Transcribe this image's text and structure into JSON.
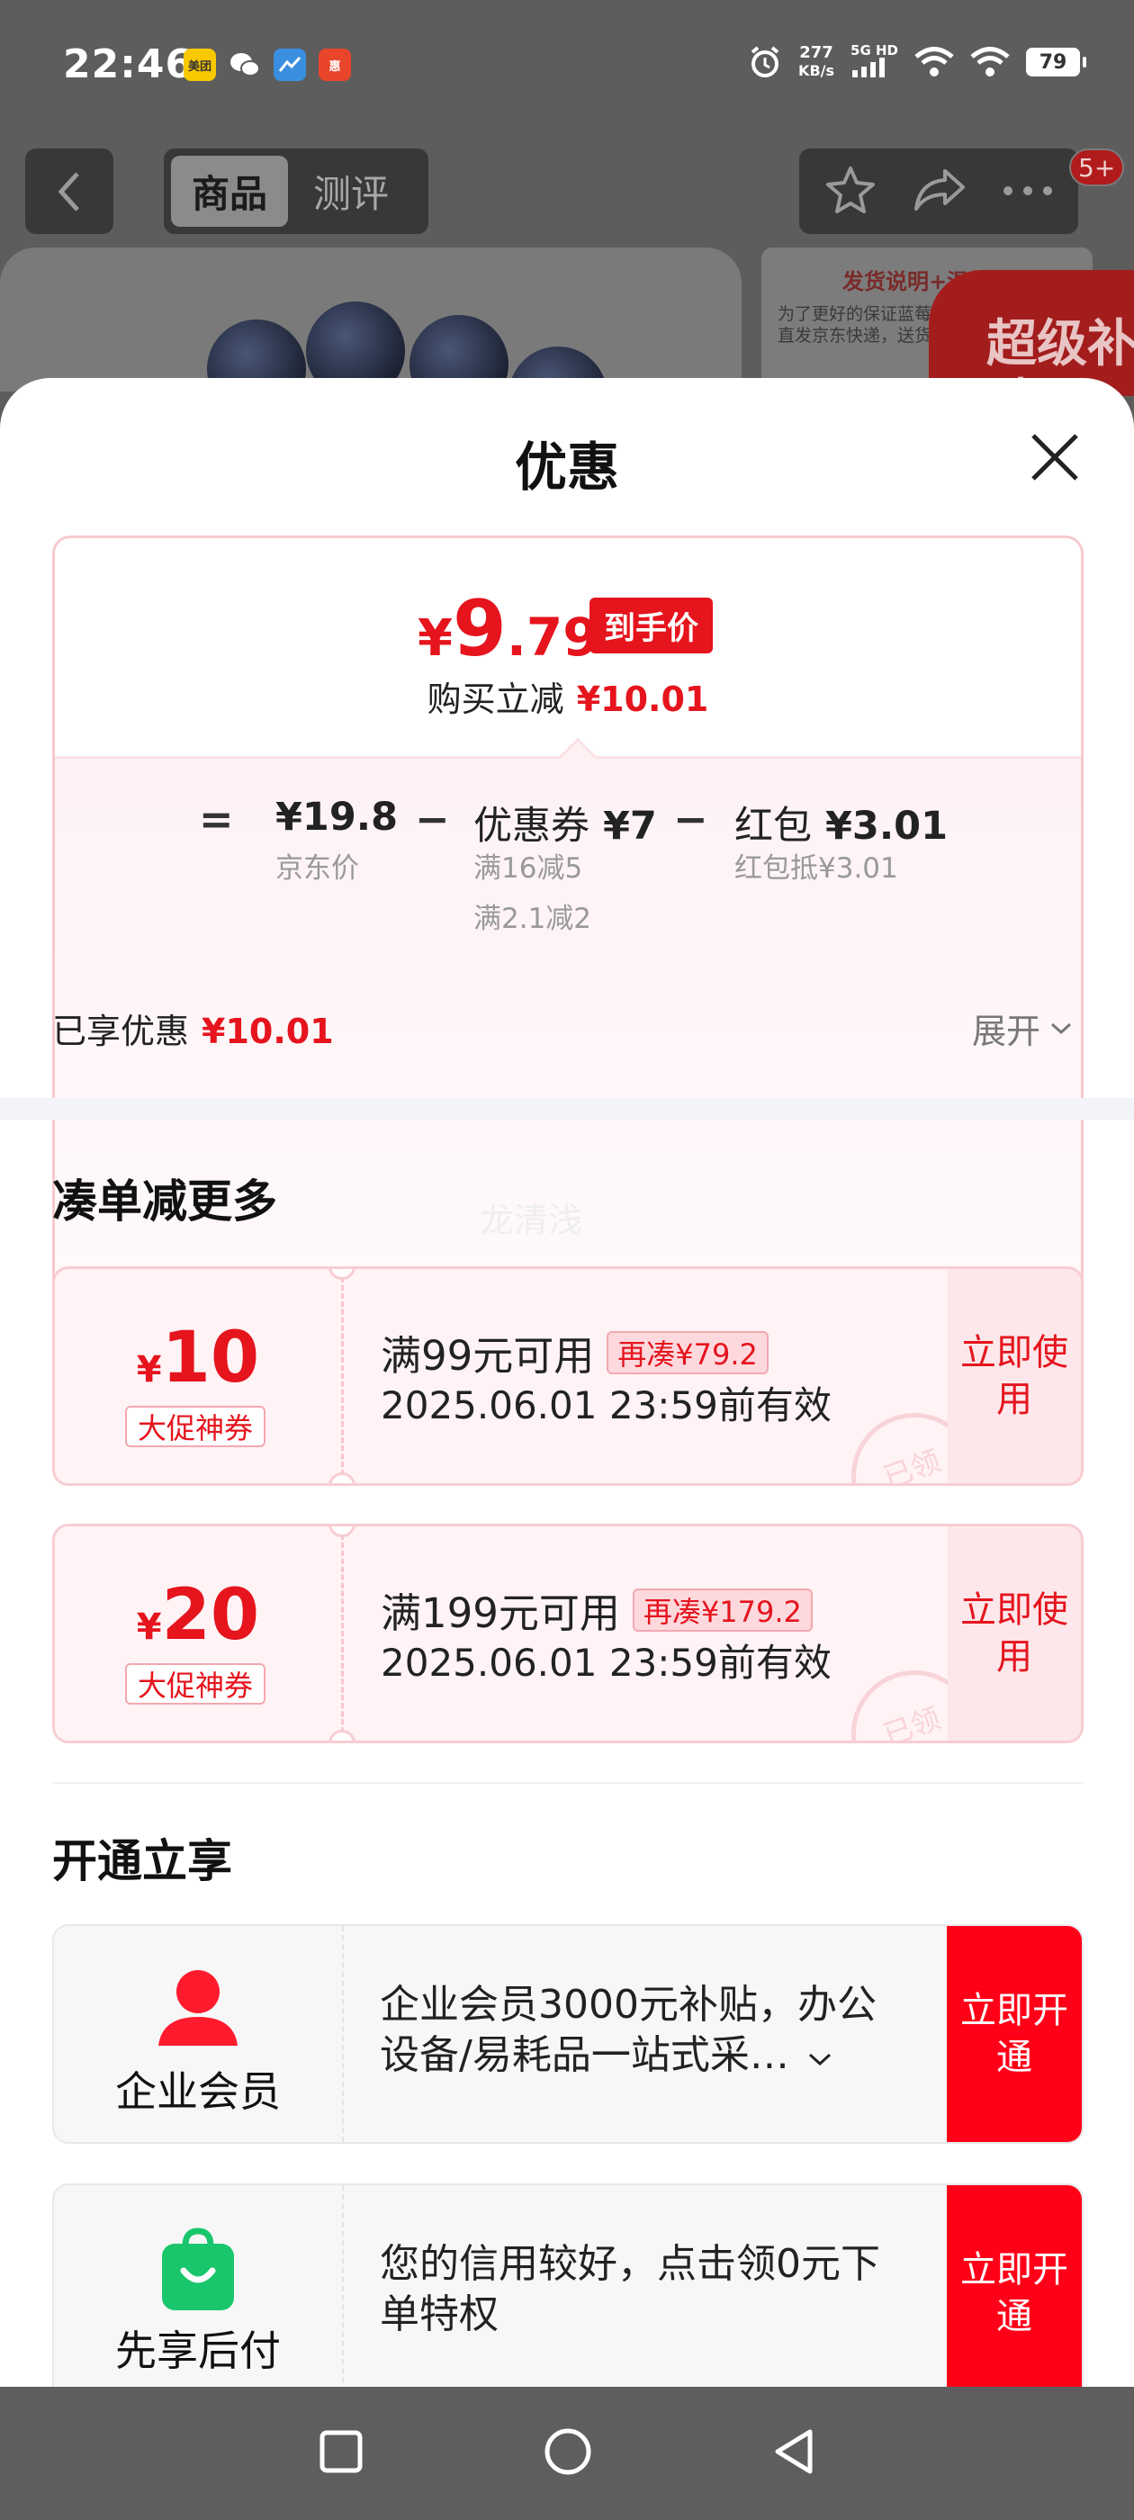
{
  "status_bar": {
    "time": "22:46",
    "app_icons": [
      "meituan-icon",
      "wechat-icon",
      "app-icon",
      "app-icon"
    ],
    "app_icon_labels": [
      "美团",
      "",
      "",
      "惠"
    ],
    "net_speed": "277",
    "net_unit": "KB/s",
    "signal_label": "5G HD",
    "battery": "79"
  },
  "page_header": {
    "tabs": [
      "商品",
      "测评"
    ],
    "active_tab": "商品",
    "message_badge": "5+"
  },
  "background_promo": {
    "title": "发货说明+温馨提示",
    "text": "为了更好的保证蓝莓的 直发京东快递，送货",
    "super_badge": "超级补贴日"
  },
  "sheet": {
    "title": "优惠",
    "final_price": {
      "symbol": "¥",
      "integer": "9",
      "decimal": ".79",
      "badge": "到手价"
    },
    "instant_discount": {
      "label": "购买立减",
      "amount": "¥10.01"
    },
    "calc": {
      "equals": "=",
      "minus": "−",
      "jd_price": {
        "value": "¥19.8",
        "label": "京东价"
      },
      "coupon": {
        "label": "优惠券",
        "value": "¥7",
        "details": [
          "满16减5",
          "满2.1减2"
        ]
      },
      "redpacket": {
        "label": "红包",
        "value": "¥3.01",
        "detail": "红包抵¥3.01"
      }
    },
    "enjoyed": {
      "label": "已享优惠",
      "amount": "¥10.01"
    },
    "expand_label": "展开",
    "section_more": "凑单减更多",
    "watermark": "龙清浅",
    "coupons": [
      {
        "symbol": "¥",
        "amount": "10",
        "tag": "大促神券",
        "condition": "满99元可用",
        "need": "再凑¥79.2",
        "expiry": "2025.06.01 23:59前有效",
        "button": "立即使用",
        "stamp": "已领"
      },
      {
        "symbol": "¥",
        "amount": "20",
        "tag": "大促神券",
        "condition": "满199元可用",
        "need": "再凑¥179.2",
        "expiry": "2025.06.01 23:59前有效",
        "button": "立即使用",
        "stamp": "已领"
      }
    ],
    "section_open": "开通立享",
    "services": [
      {
        "name": "企业会员",
        "icon": "person-icon",
        "description": "企业会员3000元补贴，办公设备/易耗品一站式采…",
        "button": "立即开通",
        "color": "#ff0018"
      },
      {
        "name": "先享后付",
        "icon": "shopping-bag-icon",
        "description": "您的信用较好，点击领0元下单特权",
        "button": "立即开通",
        "color": "#19c66b"
      }
    ]
  },
  "colors": {
    "accent": "#e5141d",
    "button_red": "#ff0018",
    "coupon_bg": "#fff3f5"
  }
}
